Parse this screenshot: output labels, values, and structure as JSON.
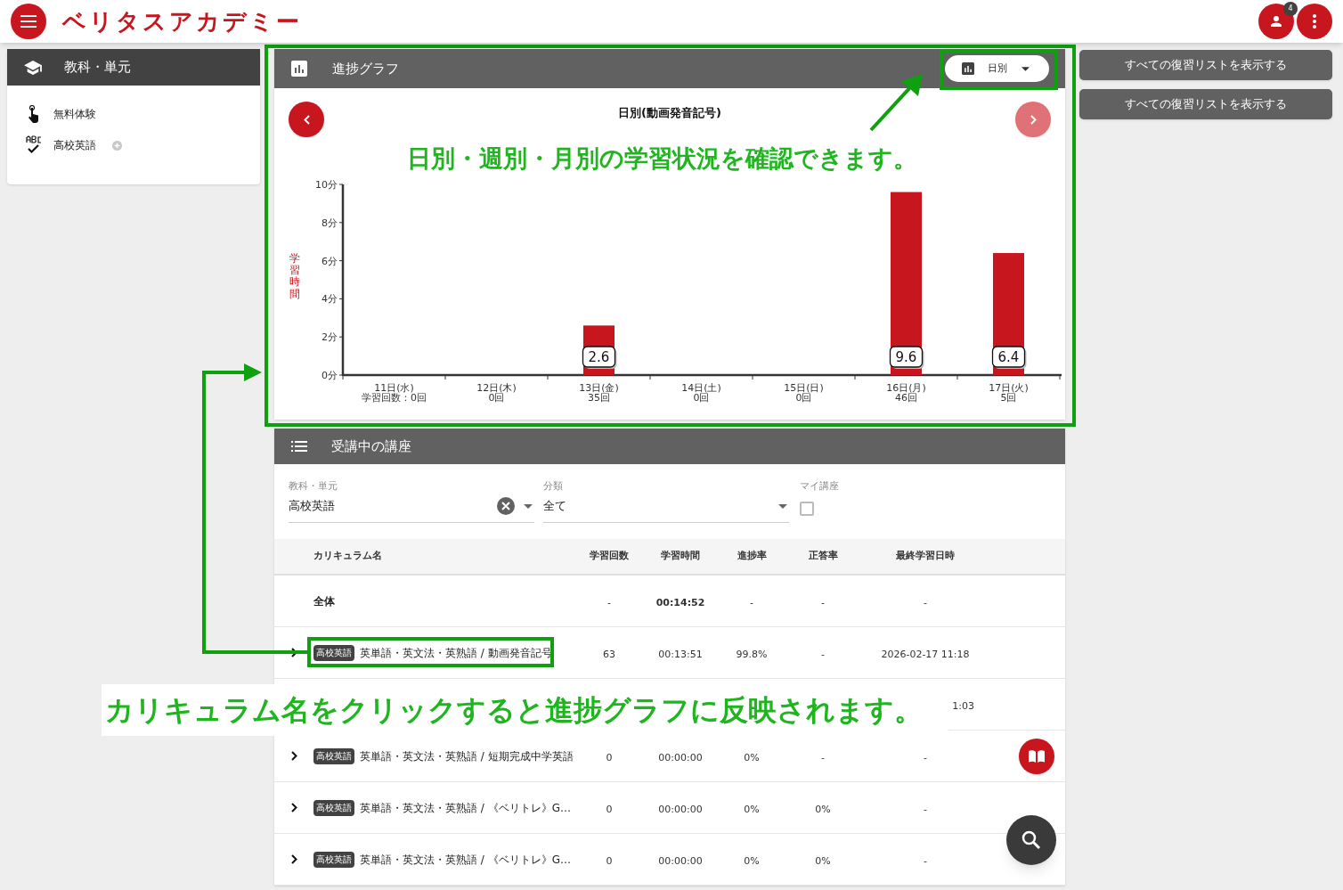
{
  "app_bar": {
    "logo": "ベリタスアカデミー",
    "notification_count": "4"
  },
  "subjects_panel": {
    "title": "教科・単元",
    "items": [
      {
        "label": "無料体験",
        "expandable": false
      },
      {
        "label": "高校英語",
        "expandable": true
      }
    ]
  },
  "progress_graph": {
    "title": "進捗グラフ",
    "period_selector": "日別",
    "prev_disabled": false,
    "next_disabled": true,
    "count_labels": [
      "学習回数：0回",
      "0回",
      "35回",
      "0回",
      "0回",
      "46回",
      "5回"
    ],
    "chart_data": {
      "type": "bar",
      "title": "日別(動画発音記号)",
      "ylabel": "学習時間",
      "categories": [
        "11日(水)",
        "12日(木)",
        "13日(金)",
        "14日(土)",
        "15日(日)",
        "16日(月)",
        "17日(火)"
      ],
      "series": [
        {
          "color": "#c8161e",
          "values": [
            0,
            0,
            2.6,
            0,
            0,
            9.6,
            6.4
          ]
        }
      ],
      "ylim": [
        0,
        10
      ],
      "yticks": [
        {
          "value": 0,
          "label": "0分"
        },
        {
          "value": 2,
          "label": "2分"
        },
        {
          "value": 4,
          "label": "4分"
        },
        {
          "value": 6,
          "label": "6分"
        },
        {
          "value": 8,
          "label": "8分"
        },
        {
          "value": 10,
          "label": "10分"
        }
      ],
      "value_labels": [
        null,
        null,
        "2.6",
        null,
        null,
        "9.6",
        "6.4"
      ]
    }
  },
  "review_buttons": [
    "すべての復習リストを表示する",
    "すべての復習リストを表示する"
  ],
  "courses": {
    "title": "受講中の講座",
    "filters": [
      {
        "label": "教科・単元",
        "value": "高校英語",
        "clearable": true
      },
      {
        "label": "分類",
        "value": "全て",
        "clearable": false
      }
    ],
    "my_courses": {
      "label": "マイ講座",
      "checked": false
    },
    "columns": [
      "カリキュラム名",
      "学習回数",
      "学習時間",
      "進捗率",
      "正答率",
      "最終学習日時"
    ],
    "rows": [
      {
        "kind": "total",
        "label": "全体",
        "count": "-",
        "time": "00:14:52",
        "progress": "-",
        "accuracy": "-",
        "last_studied": "-"
      },
      {
        "kind": "course",
        "tag": "高校英語",
        "name": "英単語・英文法・英熟語 / 動画発音記号",
        "count": "63",
        "time": "00:13:51",
        "progress": "99.8%",
        "accuracy": "-",
        "last_studied": "2026-02-17 11:18"
      },
      {
        "kind": "covered",
        "last_studied": "1:03"
      },
      {
        "kind": "course",
        "tag": "高校英語",
        "name": "英単語・英文法・英熟語 / 短期完成中学英語",
        "count": "0",
        "time": "00:00:00",
        "progress": "0%",
        "accuracy": "-",
        "last_studied": "-"
      },
      {
        "kind": "course",
        "tag": "高校英語",
        "name": "英単語・英文法・英熟語 / 《ベリトレ》G…",
        "count": "0",
        "time": "00:00:00",
        "progress": "0%",
        "accuracy": "0%",
        "last_studied": "-"
      },
      {
        "kind": "course",
        "tag": "高校英語",
        "name": "英単語・英文法・英熟語 / 《ベリトレ》G…",
        "count": "0",
        "time": "00:00:00",
        "progress": "0%",
        "accuracy": "0%",
        "last_studied": "-"
      }
    ]
  },
  "annotations": {
    "chart_note": "日別・週別・月別の学習状況を確認できます。",
    "course_note": "カリキュラム名をクリックすると進捗グラフに反映されます。"
  }
}
